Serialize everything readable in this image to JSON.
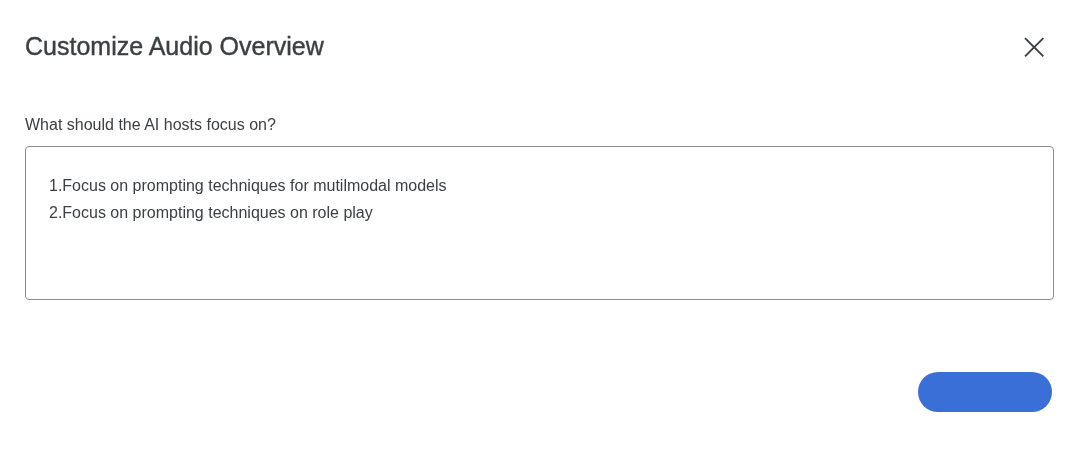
{
  "dialog": {
    "title": "Customize Audio Overview",
    "close_icon": "×"
  },
  "prompt": {
    "label": "What should the AI hosts focus on?",
    "value": "1.Focus on prompting techniques for mutilmodal models\n2.Focus on prompting techniques on role play"
  }
}
